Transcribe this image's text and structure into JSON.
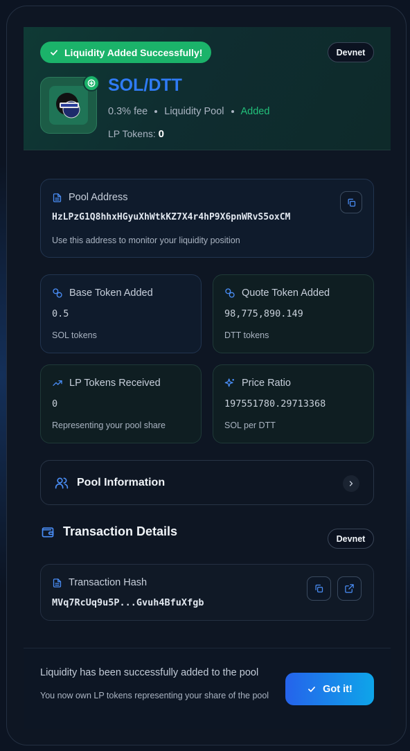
{
  "header": {
    "status": "Liquidity Added Successfully!",
    "network": "Devnet",
    "pair": "SOL/DTT",
    "fee": "0.3% fee",
    "pool_type": "Liquidity Pool",
    "state": "Added",
    "lp_label": "LP Tokens:",
    "lp_value": "0"
  },
  "pool_address": {
    "title": "Pool Address",
    "value": "HzLPzG1Q8hhxHGyuXhWtkKZ7X4r4hP9X6pnWRvS5oxCM",
    "hint": "Use this address to monitor your liquidity position"
  },
  "stats": {
    "base": {
      "title": "Base Token Added",
      "value": "0.5",
      "sub": "SOL tokens"
    },
    "quote": {
      "title": "Quote Token Added",
      "value": "98,775,890.149",
      "sub": "DTT tokens"
    },
    "lp": {
      "title": "LP Tokens Received",
      "value": "0",
      "sub": "Representing your pool share"
    },
    "ratio": {
      "title": "Price Ratio",
      "value": "197551780.29713368",
      "sub": "SOL per DTT"
    }
  },
  "pool_info": {
    "label": "Pool Information"
  },
  "transaction": {
    "section_title": "Transaction Details",
    "network": "Devnet",
    "hash_title": "Transaction Hash",
    "hash_value": "MVq7RcUq9u5P...Gvuh4BfuXfgb"
  },
  "footer": {
    "message": "Liquidity has been successfully added to the pool",
    "submessage": "You now own LP tokens representing your share of the pool",
    "button": "Got it!"
  },
  "icons": {
    "check": "check-icon",
    "plus": "plus-circle-icon",
    "document": "document-icon",
    "copy": "copy-icon",
    "coins": "coins-icon",
    "trending": "trending-up-icon",
    "sparkles": "sparkles-icon",
    "users": "users-icon",
    "chevron": "chevron-right-icon",
    "wallet": "wallet-icon",
    "external": "external-link-icon"
  },
  "colors": {
    "success": "#1bb36a",
    "accent": "#2f7bf5",
    "added": "#22c07a"
  }
}
